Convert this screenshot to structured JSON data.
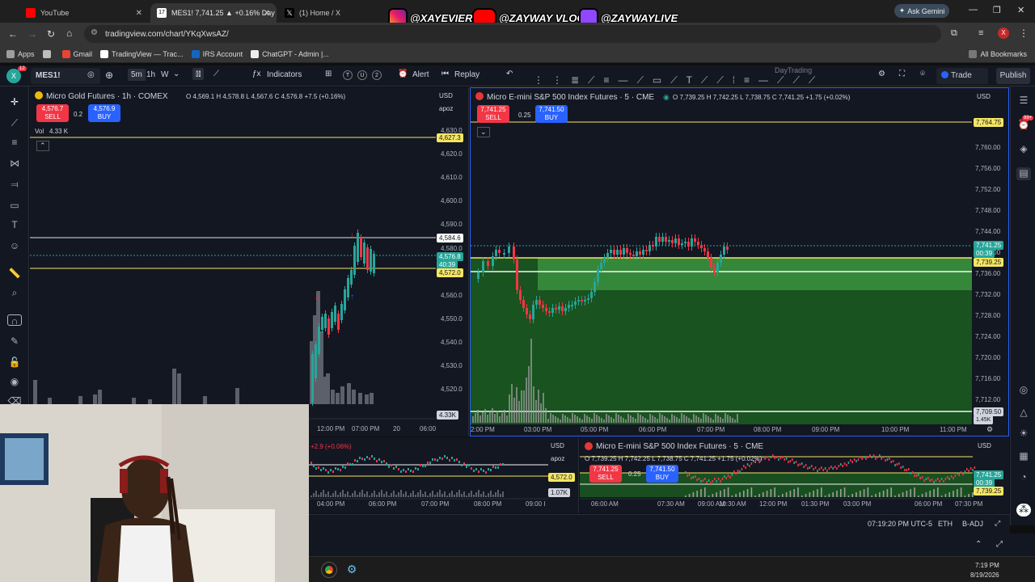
{
  "browser": {
    "tabs": [
      {
        "label": "YouTube"
      },
      {
        "label": "MES1! 7,741.25 ▲ +0.16% Day"
      },
      {
        "label": "(1) Home / X"
      }
    ],
    "url": "tradingview.com/chart/YKqXwsAZ/",
    "ask_gemini": "Ask Gemini",
    "profile_initial": "X",
    "bookmarks": [
      "Apps",
      "Gmail",
      "TradingView — Trac...",
      "IRS Account",
      "ChatGPT - Admin |..."
    ],
    "all_bookmarks": "All Bookmarks"
  },
  "overlay": {
    "instagram": "@XAYEVIER",
    "youtube": "@ZAYWAY VLOGS",
    "twitch": "@ZAYWAYLIVE"
  },
  "toolbar": {
    "avatar_badge": "12",
    "symbol": "MES1!",
    "interval": "5m",
    "interval_b": "1h",
    "interval_c": "W",
    "indicators": "Indicators",
    "badge_t": "T",
    "badge_u": "U",
    "badge_2": "2",
    "alert": "Alert",
    "replay": "Replay",
    "layout_name": "DayTrading",
    "trade": "Trade",
    "publish": "Publish"
  },
  "gold_pane": {
    "title": "Micro Gold Futures · 1h · COMEX",
    "ohlc": "O 4,569.1  H 4,578.8  L 4,567.6  C 4,576.8  +7.5 (+0.16%)",
    "sell_price": "4,576.7",
    "sell_label": "SELL",
    "spread": "0.2",
    "buy_price": "4,576.9",
    "buy_label": "BUY",
    "vol_label": "Vol",
    "vol_value": "4.33 K",
    "currency": "USD",
    "scale_mode": "apoz",
    "y_labels": [
      "4,630.0",
      "4,620.0",
      "4,610.0",
      "4,600.0",
      "4,590.0",
      "4,580.0",
      "4,570.0",
      "4,560.0",
      "4,550.0",
      "4,540.0",
      "4,530.0",
      "4,520.0"
    ],
    "price_tags": {
      "top": "4,627.3",
      "high": "4,584.6",
      "last": "4,576.8",
      "countdown": "40:39",
      "level": "4,572.0",
      "volume": "4.33K"
    },
    "x_labels": [
      "12:00 PM",
      "07:00 PM",
      "20",
      "06:00"
    ]
  },
  "es_pane": {
    "title": "Micro E-mini S&P 500 Index Futures · 5 · CME",
    "ohlc": "O 7,739.25  H 7,742.25  L 7,738.75  C 7,741.25  +1.75 (+0.02%)",
    "sell_price": "7,741.25",
    "sell_label": "SELL",
    "spread": "0.25",
    "buy_price": "7,741.50",
    "buy_label": "BUY",
    "currency": "USD",
    "y_labels": [
      "7,760.00",
      "7,756.00",
      "7,752.00",
      "7,748.00",
      "7,744.00",
      "7,740.00",
      "7,736.00",
      "7,732.00",
      "7,728.00",
      "7,724.00",
      "7,720.00",
      "7,716.00",
      "7,712.00"
    ],
    "price_tags": {
      "top": "7,764.75",
      "last": "7,741.25",
      "countdown": "00:39",
      "level": "7,739.25",
      "bottom": "7,709.50",
      "volume": "1.45K"
    },
    "x_labels": [
      "2:00 PM",
      "03:00 PM",
      "05:00 PM",
      "06:00 PM",
      "07:00 PM",
      "08:00 PM",
      "09:00 PM",
      "10:00 PM",
      "11:00 PM"
    ]
  },
  "mini_gold": {
    "ohlc": "+2.9 (+0.06%)",
    "currency": "USD",
    "scale_mode": "apoz",
    "level": "4,572.0",
    "volume": "1.07K",
    "x_labels": [
      "04:00 PM",
      "06:00 PM",
      "07:00 PM",
      "08:00 PM",
      "09:00 I"
    ]
  },
  "mini_es": {
    "title": "Micro E-mini S&P 500 Index Futures · 5 · CME",
    "ohlc": "O 7,739.25  H 7,742.25  L 7,738.75  C 7,741.25  +1.75 (+0.02%)",
    "sell_price": "7,741.25",
    "sell_label": "SELL",
    "spread": "0.25",
    "buy_price": "7,741.50",
    "buy_label": "BUY",
    "currency": "USD",
    "tags": {
      "last": "7,741.25",
      "countdown": "00:39",
      "level": "7,739.25"
    },
    "x_labels": [
      "06:00 AM",
      "07:30 AM",
      "09:00 AM",
      "10:30 AM",
      "12:00 PM",
      "01:30 PM",
      "03:00 PM",
      "06:00 PM",
      "07:30 PM"
    ]
  },
  "status": {
    "clock": "07:19:20 PM UTC-5",
    "session": "ETH",
    "adj": "B-ADJ"
  },
  "taskbar": {
    "time": "7:19 PM",
    "date": "8/19/2026"
  },
  "right_badge": "99+",
  "colors": {
    "bull": "#26a69a",
    "bear": "#f23645",
    "zone": "#1b5e20",
    "level": "#f5e663",
    "accent": "#2962ff"
  }
}
